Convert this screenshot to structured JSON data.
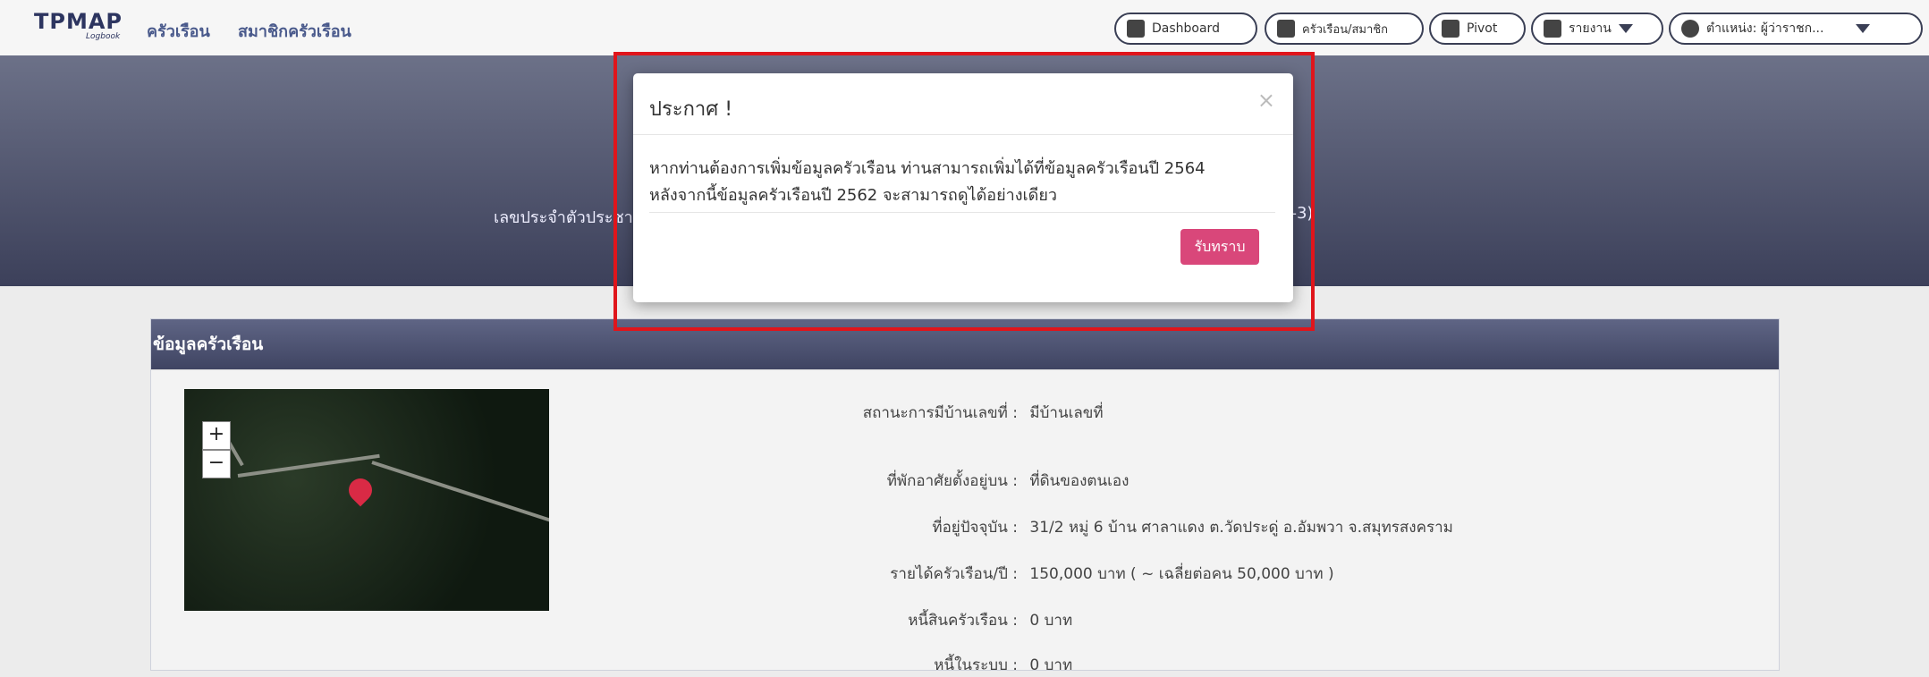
{
  "navbar": {
    "logo_text": "TPMAP",
    "logo_sub": "Logbook",
    "links": [
      "ครัวเรือน",
      "สมาชิกครัวเรือน"
    ],
    "buttons": {
      "dashboard": "Dashboard",
      "household": "ครัวเรือน/สมาชิก",
      "pivot": "Pivot",
      "report": "รายงาน",
      "position": "ตำแหน่ง: ผู้ว่าราชก..."
    }
  },
  "banner": {
    "id_label_left": "เลขประจำตัวประชาช",
    "id_label_right": "1-3)"
  },
  "panel": {
    "title": "ข้อมูลครัวเรือน",
    "map_zoom_in": "+",
    "map_zoom_out": "−",
    "rows": [
      {
        "label": "สถานะการมีบ้านเลขที่ :",
        "value": "มีบ้านเลขที่"
      },
      {
        "label": "ที่พักอาศัยตั้งอยู่บน :",
        "value": "ที่ดินของตนเอง"
      },
      {
        "label": "ที่อยู่ปัจจุบัน :",
        "value": "31/2 หมู่ 6 บ้าน ศาลาแดง ต.วัดประดู่ อ.อัมพวา จ.สมุทรสงคราม"
      },
      {
        "label": "รายได้ครัวเรือน/ปี :",
        "value": "150,000 บาท ( ~ เฉลี่ยต่อคน 50,000 บาท )"
      },
      {
        "label": "หนี้สินครัวเรือน :",
        "value": "0 บาท"
      },
      {
        "label": "หนี้ในระบบ :",
        "value": "0 บาท"
      }
    ]
  },
  "modal": {
    "title": "ประกาศ !",
    "close": "×",
    "line1": "หากท่านต้องการเพิ่มข้อมูลครัวเรือน ท่านสามารถเพิ่มได้ที่ข้อมูลครัวเรือนปี 2564",
    "line2": "หลังจากนี้ข้อมูลครัวเรือนปี 2562 จะสามารถดูได้อย่างเดียว",
    "ack_label": "รับทราบ"
  },
  "colors": {
    "highlight_box": "#e0151b",
    "ack_button": "#d9477a",
    "nav_link": "#4a5a8c"
  }
}
